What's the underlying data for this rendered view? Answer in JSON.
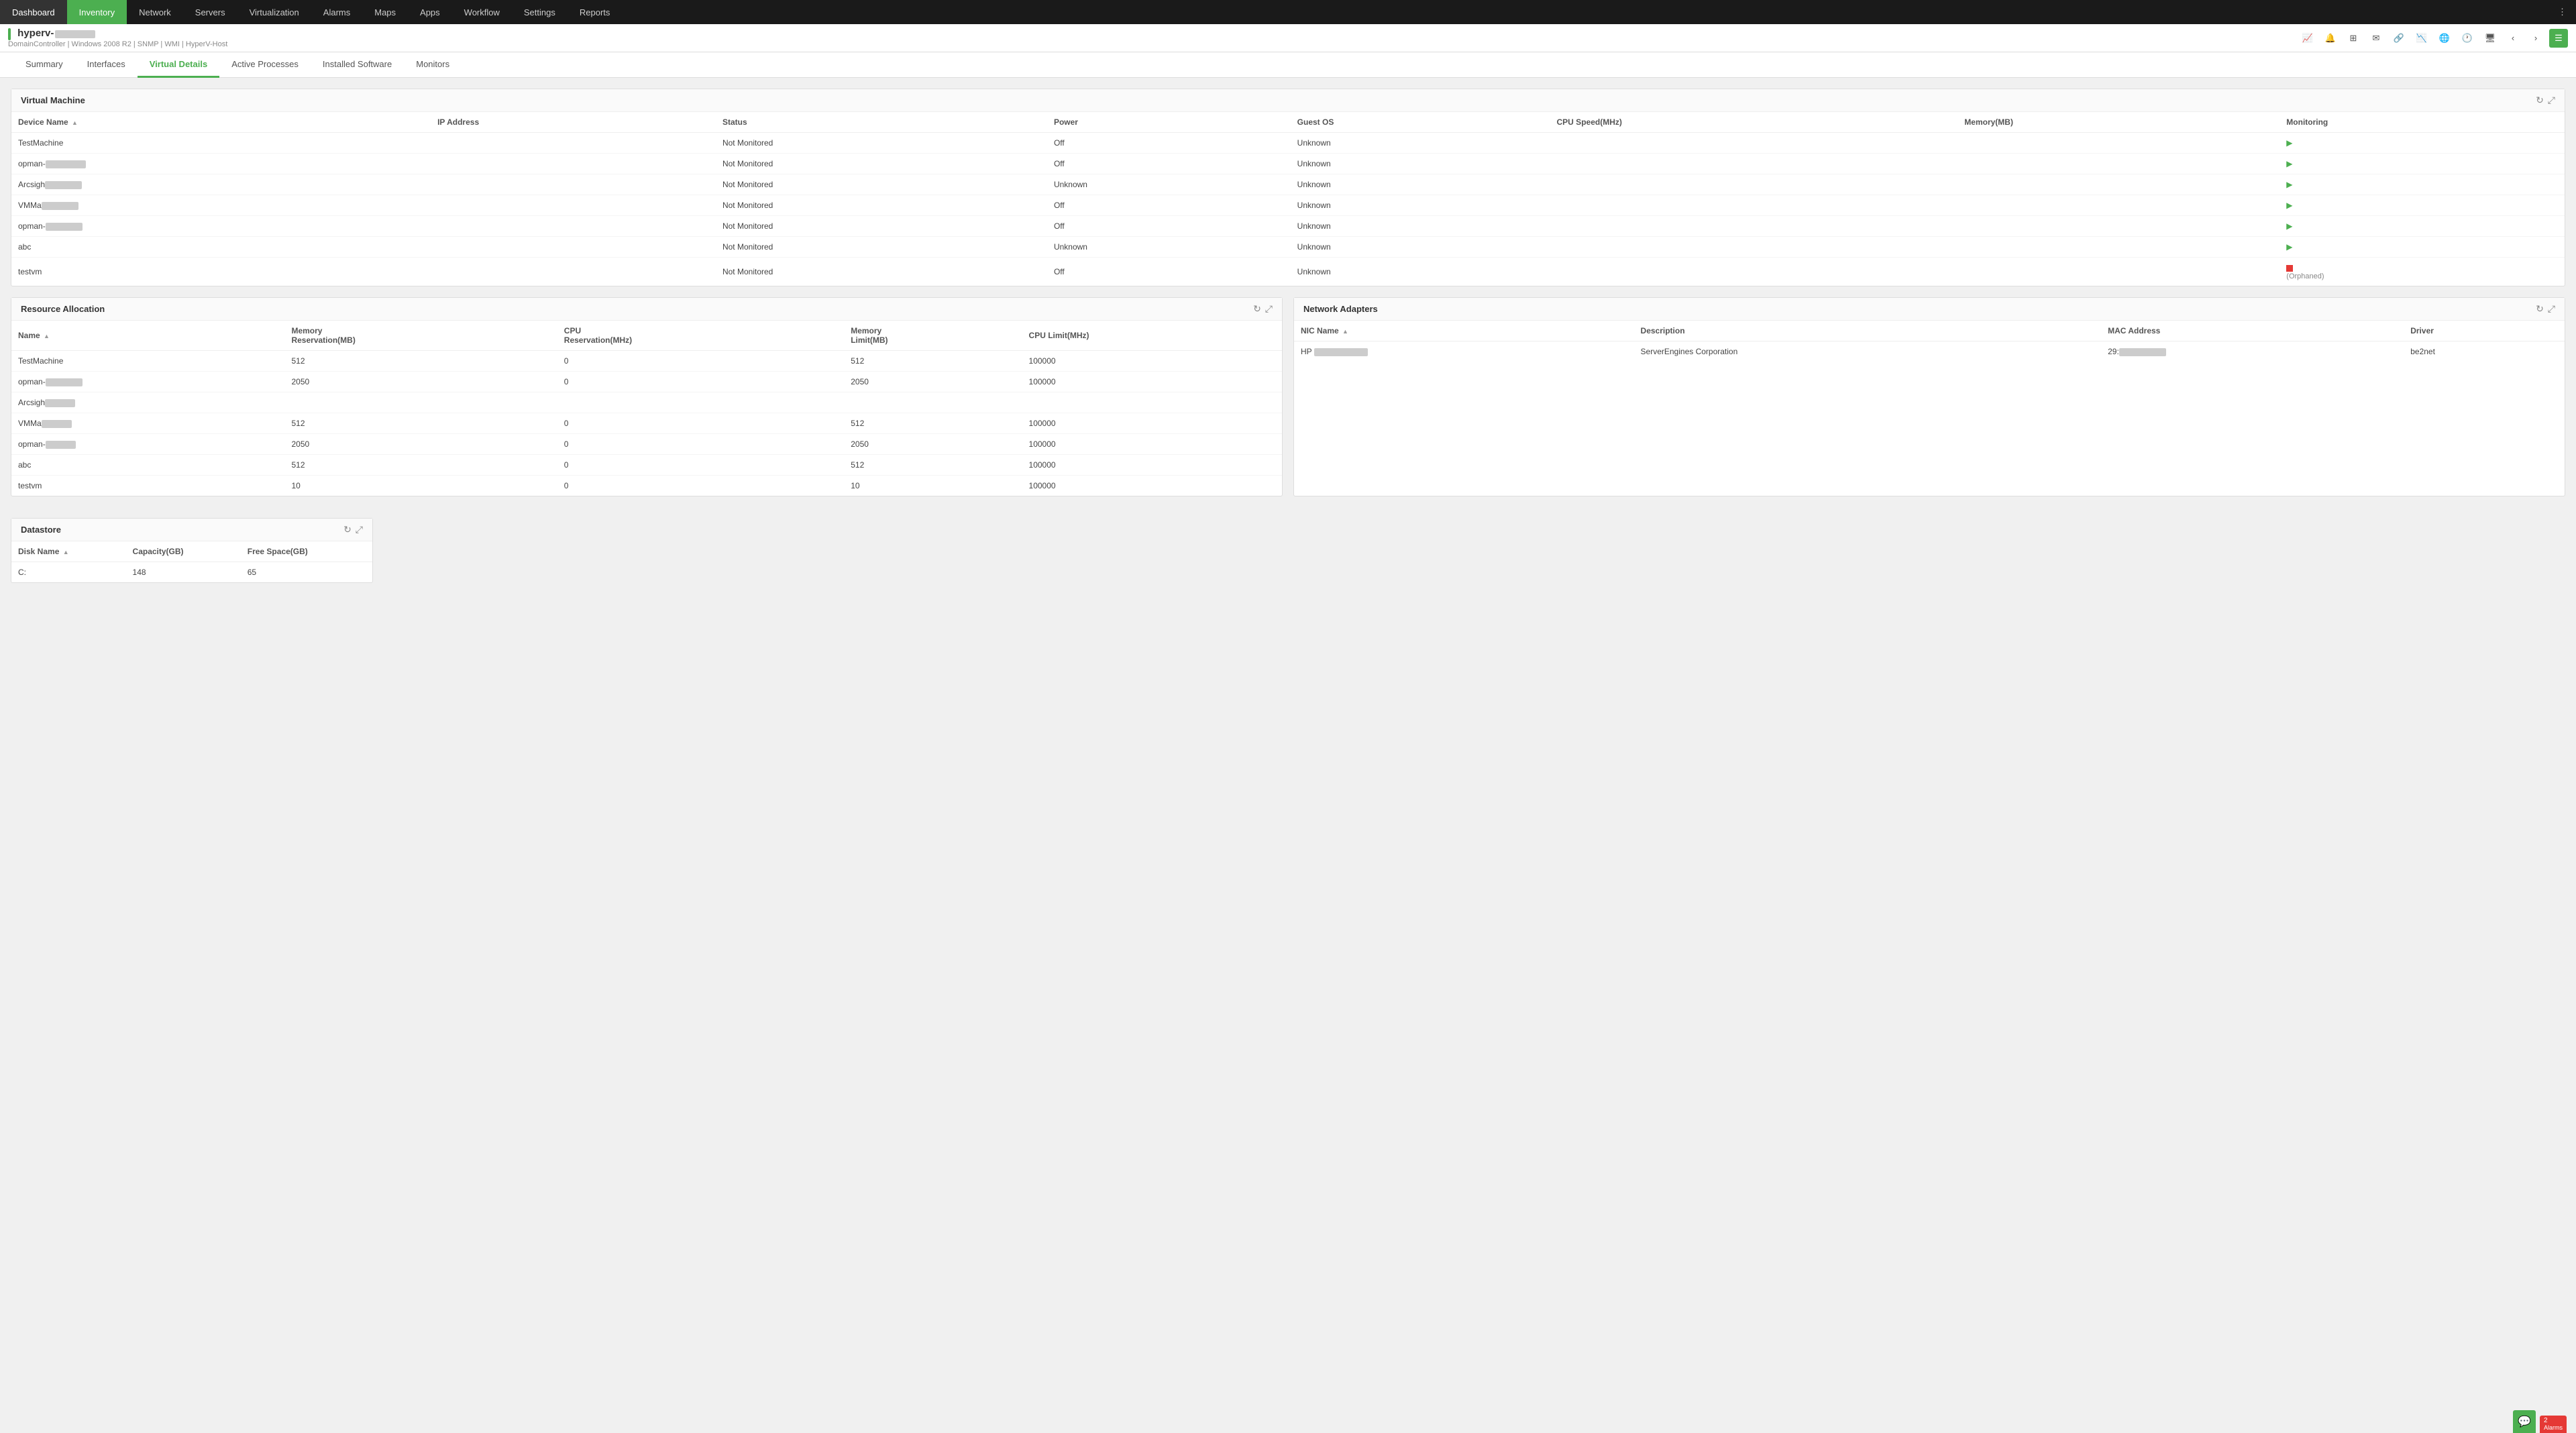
{
  "nav": {
    "items": [
      {
        "label": "Dashboard",
        "active": false
      },
      {
        "label": "Inventory",
        "active": true
      },
      {
        "label": "Network",
        "active": false
      },
      {
        "label": "Servers",
        "active": false
      },
      {
        "label": "Virtualization",
        "active": false
      },
      {
        "label": "Alarms",
        "active": false
      },
      {
        "label": "Maps",
        "active": false
      },
      {
        "label": "Apps",
        "active": false
      },
      {
        "label": "Workflow",
        "active": false
      },
      {
        "label": "Settings",
        "active": false
      },
      {
        "label": "Reports",
        "active": false
      }
    ]
  },
  "host": {
    "name": "hyperv-",
    "meta": "DomainController | Windows 2008 R2 | SNMP | WMI | HyperV-Host"
  },
  "tabs": [
    {
      "label": "Summary",
      "active": false
    },
    {
      "label": "Interfaces",
      "active": false
    },
    {
      "label": "Virtual Details",
      "active": true
    },
    {
      "label": "Active Processes",
      "active": false
    },
    {
      "label": "Installed Software",
      "active": false
    },
    {
      "label": "Monitors",
      "active": false
    }
  ],
  "virtual_machine": {
    "title": "Virtual Machine",
    "columns": [
      "Device Name",
      "IP Address",
      "Status",
      "Power",
      "Guest OS",
      "CPU Speed(MHz)",
      "Memory(MB)",
      "Monitoring"
    ],
    "rows": [
      {
        "device": "TestMachine",
        "ip": "",
        "status": "Not Monitored",
        "power": "Off",
        "guest_os": "Unknown",
        "cpu": "",
        "memory": "",
        "monitoring": "play"
      },
      {
        "device": "opman-",
        "ip": "",
        "status": "Not Monitored",
        "power": "Off",
        "guest_os": "Unknown",
        "cpu": "",
        "memory": "",
        "monitoring": "play",
        "redacted": true
      },
      {
        "device": "Arcsigh",
        "ip": "",
        "status": "Not Monitored",
        "power": "Unknown",
        "guest_os": "Unknown",
        "cpu": "",
        "memory": "",
        "monitoring": "play",
        "redacted": true
      },
      {
        "device": "VMMa",
        "ip": "",
        "status": "Not Monitored",
        "power": "Off",
        "guest_os": "Unknown",
        "cpu": "",
        "memory": "",
        "monitoring": "play",
        "redacted": true
      },
      {
        "device": "opman-",
        "ip": "",
        "status": "Not Monitored",
        "power": "Off",
        "guest_os": "Unknown",
        "cpu": "",
        "memory": "",
        "monitoring": "play",
        "redacted": true
      },
      {
        "device": "abc",
        "ip": "",
        "status": "Not Monitored",
        "power": "Unknown",
        "guest_os": "Unknown",
        "cpu": "",
        "memory": "",
        "monitoring": "play"
      },
      {
        "device": "testvm",
        "ip": "",
        "status": "Not Monitored",
        "power": "Off",
        "guest_os": "Unknown",
        "cpu": "",
        "memory": "",
        "monitoring": "orphaned"
      }
    ]
  },
  "resource_allocation": {
    "title": "Resource Allocation",
    "columns": [
      "Name",
      "Memory Reservation(MB)",
      "CPU Reservation(MHz)",
      "Memory Limit(MB)",
      "CPU Limit(MHz)"
    ],
    "rows": [
      {
        "name": "TestMachine",
        "mem_res": "512",
        "cpu_res": "0",
        "mem_lim": "512",
        "cpu_lim": "100000",
        "redacted": false
      },
      {
        "name": "opman-",
        "mem_res": "2050",
        "cpu_res": "0",
        "mem_lim": "2050",
        "cpu_lim": "100000",
        "redacted": true
      },
      {
        "name": "Arcsigh",
        "mem_res": "",
        "cpu_res": "",
        "mem_lim": "",
        "cpu_lim": "",
        "redacted": true
      },
      {
        "name": "VMMa",
        "mem_res": "512",
        "cpu_res": "0",
        "mem_lim": "512",
        "cpu_lim": "100000",
        "redacted": true
      },
      {
        "name": "opman-",
        "mem_res": "2050",
        "cpu_res": "0",
        "mem_lim": "2050",
        "cpu_lim": "100000",
        "redacted": true
      },
      {
        "name": "abc",
        "mem_res": "512",
        "cpu_res": "0",
        "mem_lim": "512",
        "cpu_lim": "100000",
        "redacted": false
      },
      {
        "name": "testvm",
        "mem_res": "10",
        "cpu_res": "0",
        "mem_lim": "10",
        "cpu_lim": "100000",
        "redacted": false
      }
    ]
  },
  "network_adapters": {
    "title": "Network Adapters",
    "columns": [
      "NIC Name",
      "Description",
      "MAC Address",
      "Driver"
    ],
    "rows": [
      {
        "nic": "HP",
        "description": "ServerEngines Corporation",
        "mac": "29:",
        "driver": "be2net",
        "nic_redacted": true,
        "mac_redacted": true
      }
    ]
  },
  "datastore": {
    "title": "Datastore",
    "columns": [
      "Disk Name",
      "Capacity(GB)",
      "Free Space(GB)"
    ],
    "rows": [
      {
        "disk": "C:",
        "capacity": "148",
        "free": "65"
      }
    ]
  },
  "bottom_badge": {
    "alerts": "2",
    "alerts_label": "Alarms"
  }
}
